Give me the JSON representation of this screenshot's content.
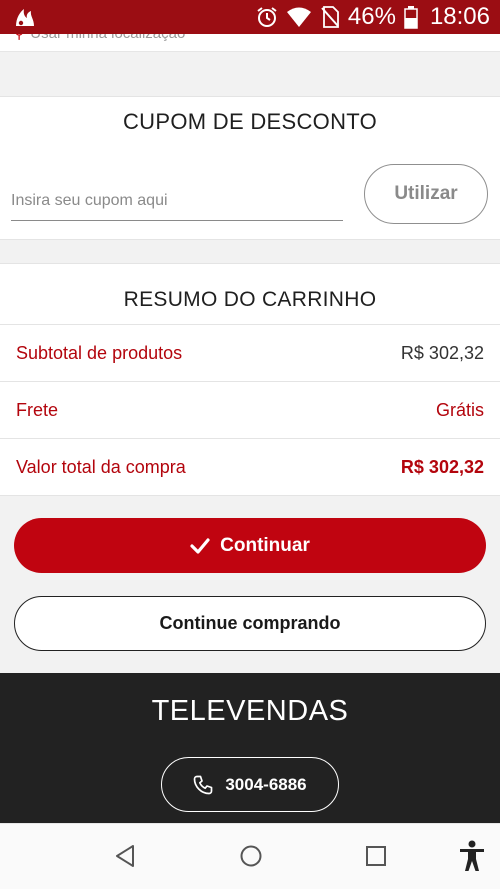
{
  "status_bar": {
    "battery": "46%",
    "time": "18:06",
    "icons": [
      "notification-app-icon",
      "alarm-icon",
      "wifi-icon",
      "no-sim-icon",
      "battery-icon"
    ]
  },
  "location": {
    "text": "Usar minha localização",
    "icon": "map-pin-icon"
  },
  "coupon": {
    "title": "CUPOM DE DESCONTO",
    "placeholder": "Insira seu cupom aqui",
    "value": "",
    "button_label": "Utilizar"
  },
  "summary": {
    "title": "RESUMO DO CARRINHO",
    "rows": [
      {
        "label": "Subtotal de produtos",
        "value": "R$ 302,32"
      },
      {
        "label": "Frete",
        "value": "Grátis"
      },
      {
        "label": "Valor total da compra",
        "value": "R$ 302,32"
      }
    ]
  },
  "actions": {
    "continue_label": "Continuar",
    "keep_shopping_label": "Continue comprando"
  },
  "footer": {
    "title": "TELEVENDAS",
    "phone": "3004-6886"
  },
  "colors": {
    "brand_red": "#c00410",
    "status_bar": "#9b0d13",
    "footer_bg": "#222222"
  },
  "nav_icons": [
    "back-icon",
    "home-icon",
    "recents-icon",
    "accessibility-icon"
  ]
}
